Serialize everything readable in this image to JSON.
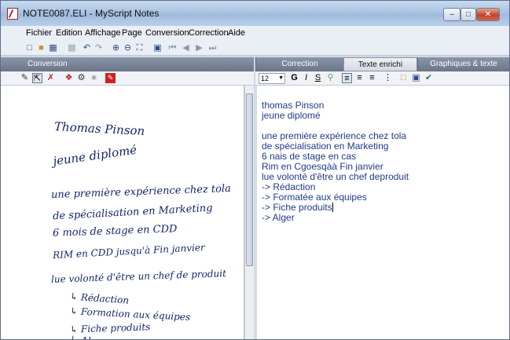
{
  "window": {
    "title": "NOTE0087.ELI - MyScript Notes"
  },
  "menu": [
    "Fichier",
    "Edition",
    "Affichage",
    "Page",
    "Conversion",
    "Correction",
    "Aide"
  ],
  "left_panel": {
    "header": "Conversion"
  },
  "right_panel": {
    "tabs": [
      "Correction",
      "Texte enrichi",
      "Graphiques & texte"
    ],
    "active_tab": "Texte enrichi",
    "font_size": "12"
  },
  "ink_lines": [
    "Thomas Pinson",
    "jeune diplomé",
    "une première expérience chez tola",
    "de spécialisation en Marketing",
    "6 mois de stage en CDD",
    "RIM en CDD jusqu'à Fin janvier",
    "lue volonté d'être un chef de produit",
    "↳ Rédaction",
    "↳ Formation aux équipes",
    "↳ Fiche produits",
    "↳ Alger"
  ],
  "text_lines": [
    "thomas Pinson",
    "jeune  diplomé",
    "",
    "une première expérience chez tola",
    "de spécialisation en Marketing",
    "6 nais de stage en cas",
    "Rim en Cgoesqàà Fin janvier",
    "lue volonté d'être un chef deproduit",
    "-> Rédaction",
    "-> Formatée aux équipes",
    "-> Fiche produits",
    "-> Alger"
  ],
  "icons": {
    "toolbar": [
      "new-icon",
      "open-icon",
      "save-icon",
      "print-icon",
      "undo-icon",
      "redo-icon",
      "zoom-in-icon",
      "zoom-out-icon",
      "fit-page-icon",
      "page-number-icon",
      "first-page-icon",
      "previous-page-icon",
      "next-page-icon",
      "last-page-icon"
    ],
    "left_subtoolbar": [
      "pen-icon",
      "selection-icon",
      "eraser-icon",
      "convert-icon",
      "recognize-icon",
      "options-icon",
      "pdf-icon"
    ],
    "right_subtoolbar": [
      "bold-icon",
      "italic-icon",
      "underline-icon",
      "find-icon",
      "align-left-icon",
      "align-center-icon",
      "align-right-icon",
      "bullet-list-icon",
      "insert-icon",
      "image-icon",
      "spellcheck-icon"
    ]
  }
}
